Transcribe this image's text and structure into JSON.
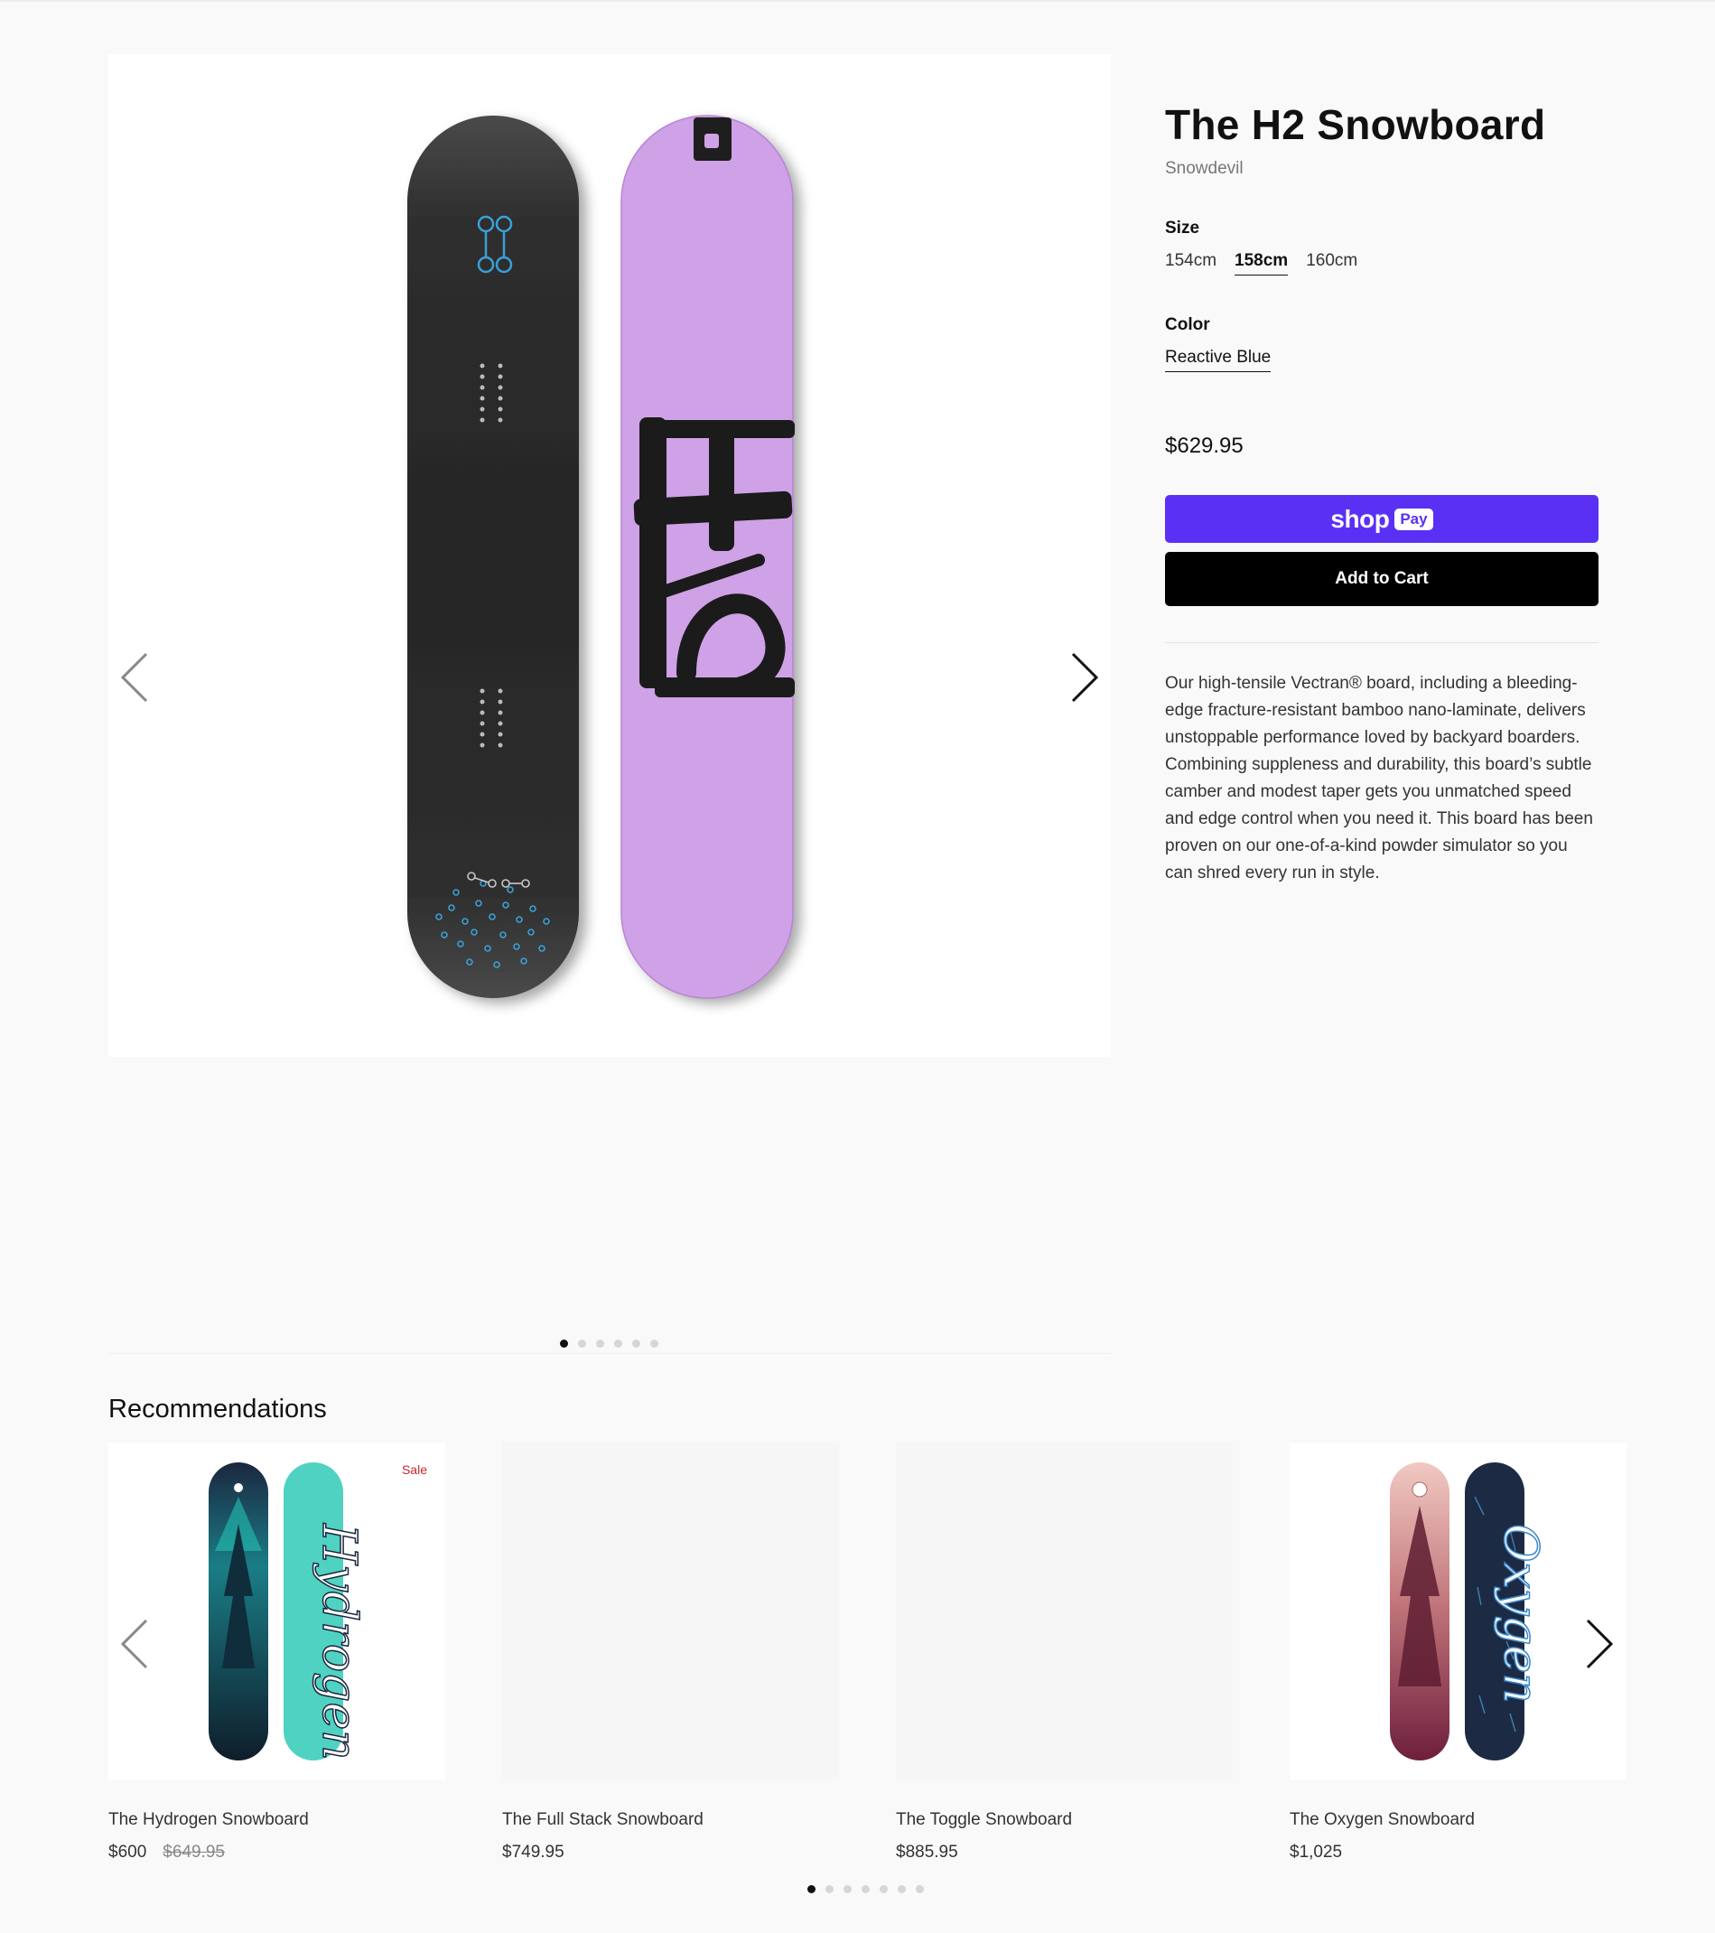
{
  "product": {
    "title": "The H2 Snowboard",
    "vendor": "Snowdevil",
    "size_label": "Size",
    "sizes": [
      "154cm",
      "158cm",
      "160cm"
    ],
    "selected_size": "158cm",
    "color_label": "Color",
    "selected_color": "Reactive Blue",
    "price": "$629.95",
    "shop_pay": {
      "shop": "shop",
      "pay": "Pay"
    },
    "add_to_cart": "Add to Cart",
    "description": "Our high-tensile Vectran® board, including a bleeding-edge fracture-resistant bamboo nano-laminate, delivers unstoppable performance loved by backyard boarders.\nCombining suppleness and durability, this board’s subtle camber and modest taper gets you unmatched speed and edge control when you need it. This board has been proven on our one-of-a-kind powder simulator so you can shred every run in style.",
    "image_text": "H2"
  },
  "gallery": {
    "slide_count": 6,
    "active_index": 0
  },
  "recommendations": {
    "title": "Recommendations",
    "items": [
      {
        "name": "The Hydrogen Snowboard",
        "price": "$600",
        "compare_price": "$649.95",
        "badge": "Sale",
        "image_text": "Hydrogen"
      },
      {
        "name": "The Full Stack Snowboard",
        "price": "$749.95",
        "compare_price": "",
        "badge": ""
      },
      {
        "name": "The Toggle Snowboard",
        "price": "$885.95",
        "compare_price": "",
        "badge": ""
      },
      {
        "name": "The Oxygen Snowboard",
        "price": "$1,025",
        "compare_price": "",
        "badge": "",
        "image_text": "Oxygen"
      }
    ],
    "dot_count": 7,
    "active_index": 0
  },
  "colors": {
    "shop_pay": "#5a31f4",
    "sale": "#c8272d",
    "h2_board": "#cfa1e6"
  }
}
